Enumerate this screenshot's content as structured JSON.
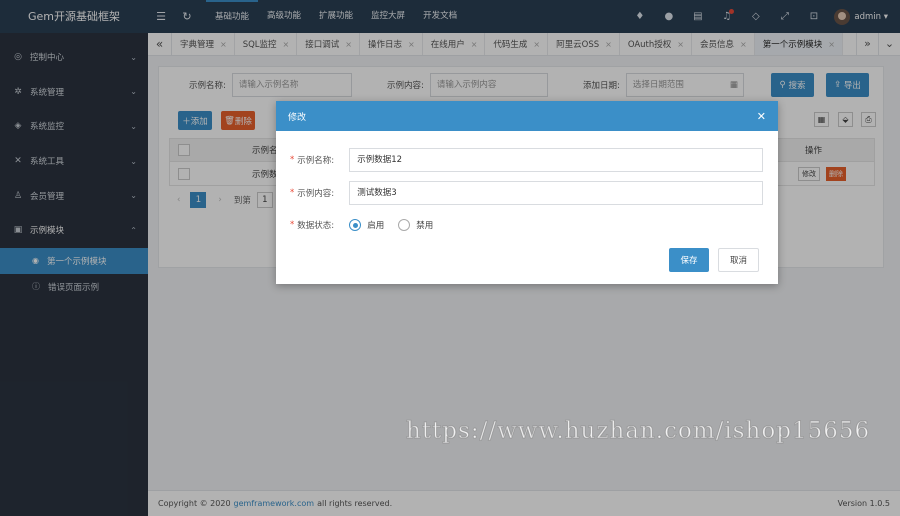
{
  "sidebar": {
    "brand": "Gem开源基础框架",
    "items": [
      {
        "label": "控制中心",
        "icon": "dashboard-icon"
      },
      {
        "label": "系统管理",
        "icon": "gear-icon"
      },
      {
        "label": "系统监控",
        "icon": "layers-icon"
      },
      {
        "label": "系统工具",
        "icon": "tools-icon"
      },
      {
        "label": "会员管理",
        "icon": "user-icon"
      },
      {
        "label": "示例模块",
        "icon": "module-icon"
      }
    ],
    "subitems": [
      {
        "label": "第一个示例模块",
        "icon": "radio-dot-icon"
      },
      {
        "label": "错误页面示例",
        "icon": "info-circle-icon"
      }
    ]
  },
  "topbar": {
    "nav": [
      "基础功能",
      "高级功能",
      "扩展功能",
      "监控大屏",
      "开发文档"
    ],
    "user": "admin"
  },
  "tabs": [
    "字典管理",
    "SQL监控",
    "接口调试",
    "操作日志",
    "在线用户",
    "代码生成",
    "阿里云OSS",
    "OAuth授权",
    "会员信息",
    "第一个示例模块"
  ],
  "search": {
    "name_label": "示例名称:",
    "name_placeholder": "请输入示例名称",
    "content_label": "示例内容:",
    "content_placeholder": "请输入示例内容",
    "date_label": "添加日期:",
    "date_placeholder": "选择日期范围",
    "search_btn": "搜索",
    "export_btn": "导出"
  },
  "toolbar": {
    "add": "添加",
    "delete": "删除"
  },
  "table": {
    "header_name": "示例名",
    "header_action": "操作",
    "row_name": "示例数",
    "edit": "修改",
    "del": "删除"
  },
  "pager": {
    "current": "1",
    "goto": "到第",
    "page_input": "1"
  },
  "dialog": {
    "title": "修改",
    "name_label": "示例名称:",
    "name_value": "示例数据12",
    "content_label": "示例内容:",
    "content_value": "测试数据3",
    "status_label": "数据状态:",
    "opt_enable": "启用",
    "opt_disable": "禁用",
    "save": "保存",
    "cancel": "取消"
  },
  "footer": {
    "copyright_pre": "Copyright © 2020",
    "link": "gemframework.com",
    "copyright_post": "all rights reserved.",
    "version": "Version 1.0.5"
  },
  "watermark": "https://www.huzhan.com/ishop15656"
}
